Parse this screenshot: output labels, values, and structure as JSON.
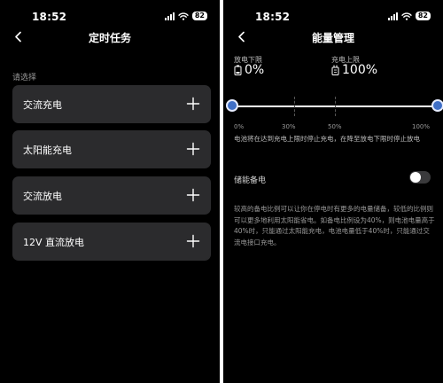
{
  "left": {
    "status": {
      "time": "18:52",
      "battery": "82"
    },
    "nav": {
      "title": "定时任务"
    },
    "section_label": "请选择",
    "tasks": [
      {
        "label": "交流充电"
      },
      {
        "label": "太阳能充电"
      },
      {
        "label": "交流放电"
      },
      {
        "label": "12V 直流放电"
      }
    ],
    "icons": {
      "back": "chevron-left-icon",
      "add": "plus-icon",
      "wifi": "wifi-icon",
      "signal": "signal-icon"
    }
  },
  "right": {
    "status": {
      "time": "18:52",
      "battery": "82"
    },
    "nav": {
      "title": "能量管理"
    },
    "discharge_limit": {
      "label": "放电下限",
      "value": "0%",
      "icon": "battery-icon"
    },
    "charge_limit": {
      "label": "充电上限",
      "value": "100%",
      "icon": "plug-icon"
    },
    "slider": {
      "min_value": 0,
      "max_value": 100,
      "ticks": [
        "0%",
        "30%",
        "50%",
        "100%"
      ],
      "accent_color": "#3f6fc6"
    },
    "description": "电池将在达到充电上限时停止充电，在降至放电下限时停止放电",
    "backup": {
      "label": "储能备电",
      "enabled": false,
      "description": "较高的备电比例可以让你在停电时有更多的电量储备，较低的比例则可以更多地利用太阳能省电。如备电比例设为40%，则电池电量高于40%时，只能通过太阳能充电，电池电量低于40%时，只能通过交流电接口充电。"
    }
  }
}
